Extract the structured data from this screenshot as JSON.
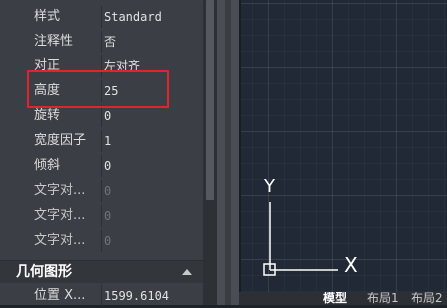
{
  "properties": {
    "rows": [
      {
        "label": "样式",
        "value": "Standard"
      },
      {
        "label": "注释性",
        "value": "否"
      },
      {
        "label": "对正",
        "value": "左对齐"
      },
      {
        "label": "高度",
        "value": "25"
      },
      {
        "label": "旋转",
        "value": "0"
      },
      {
        "label": "宽度因子",
        "value": "1"
      },
      {
        "label": "倾斜",
        "value": "0"
      },
      {
        "label": "文字对...",
        "value": "0"
      },
      {
        "label": "文字对...",
        "value": "0"
      },
      {
        "label": "文字对...",
        "value": "0"
      }
    ],
    "geometry_section": {
      "title": "几何图形",
      "rows": [
        {
          "label": "位置 X...",
          "value": "1599.6104"
        }
      ]
    }
  },
  "canvas": {
    "ucs": {
      "y_label": "Y",
      "x_label": "X"
    }
  },
  "layout_tabs": [
    "模型",
    "布局1",
    "布局2"
  ],
  "colors": {
    "highlight": "#e0242b",
    "canvas_bg": "#212836",
    "panel_bg": "#3b3e44"
  }
}
